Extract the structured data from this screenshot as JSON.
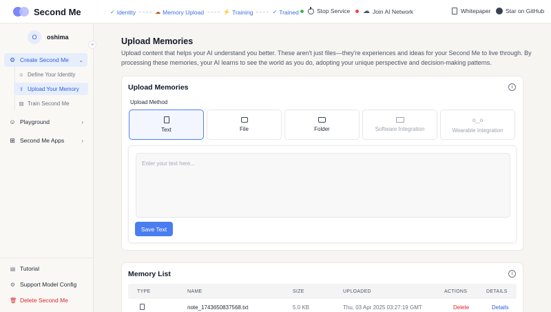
{
  "app": {
    "name": "Second Me"
  },
  "steps": [
    {
      "icon": "✓",
      "label": "Identity"
    },
    {
      "icon": "☁",
      "label": "Memory Upload"
    },
    {
      "icon": "⚡",
      "label": "Training"
    },
    {
      "icon": "✓",
      "label": "Trained"
    }
  ],
  "status": {
    "stop_service": "Stop Service",
    "stop_dot_color": "#4caf50",
    "join_network": "Join AI Network",
    "join_dot_color": "#ef4444"
  },
  "toplinks": {
    "whitepaper": "Whitepaper",
    "github": "Star on GitHub"
  },
  "user": {
    "initial": "O",
    "name": "oshima"
  },
  "sidebar": {
    "create": "Create Second Me",
    "subs": [
      "Define Your Identity",
      "Upload Your Memory",
      "Train Second Me"
    ],
    "playground": "Playground",
    "apps": "Second Me Apps",
    "tutorial": "Tutorial",
    "support": "Support Model Config",
    "delete": "Delete Second Me"
  },
  "page": {
    "title": "Upload Memories",
    "description": "Upload content that helps your AI understand you better. These aren't just files—they're experiences and ideas for your Second Me to live through. By processing these memories, your AI learns to see the world as you do, adopting your unique perspective and decision-making patterns."
  },
  "upload": {
    "title": "Upload Memories",
    "method_label": "Upload Method",
    "methods": [
      "Text",
      "File",
      "Folder",
      "Software Integration",
      "Wearable Integration"
    ],
    "selected_method": "Text",
    "placeholder": "Enter your text here...",
    "save_label": "Save Text"
  },
  "memory_list": {
    "title": "Memory List",
    "columns": [
      "TYPE",
      "NAME",
      "SIZE",
      "UPLOADED",
      "ACTIONS",
      "DETAILS"
    ],
    "rows": [
      {
        "name": "note_1743650837568.txt",
        "size": "5.0 KB",
        "uploaded": "Thu, 03 Apr 2025 03:27:19 GMT",
        "action": "Delete",
        "details": "Details"
      }
    ]
  }
}
